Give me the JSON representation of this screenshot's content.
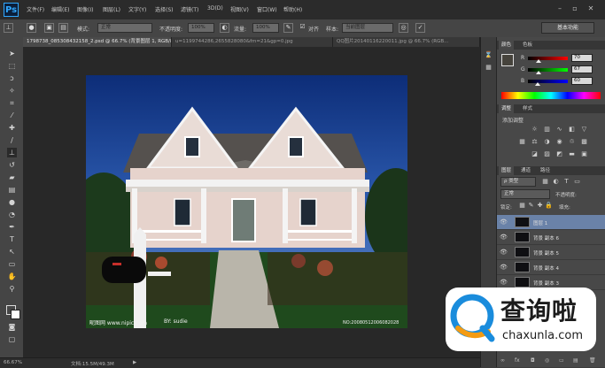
{
  "app": {
    "logo": "Ps",
    "menu": [
      "文件(F)",
      "编辑(E)",
      "图像(I)",
      "图层(L)",
      "文字(Y)",
      "选择(S)",
      "滤镜(T)",
      "3D(D)",
      "视图(V)",
      "窗口(W)",
      "帮助(H)"
    ],
    "window_controls": [
      "–",
      "▫",
      "✕"
    ]
  },
  "options": {
    "mode_label": "模式:",
    "mode_value": "正常",
    "opacity_label": "不透明度:",
    "opacity_value": "100%",
    "flow_label": "流量:",
    "flow_value": "100%",
    "align_label": "对齐",
    "sample_label": "样本:",
    "sample_value": "当前图层",
    "workspace": "基本功能"
  },
  "tabs": [
    {
      "label": "1798738_085308432158_2.psd @ 66.7% (背景图层 1, RGB/8#) *",
      "active": true
    },
    {
      "label": "u=1199744286,2655828080&fm=21&gp=0.jpg",
      "active": false
    },
    {
      "label": "QQ图片20140116220011.jpg @ 66.7% (RGB...",
      "active": false
    }
  ],
  "canvas": {
    "watermark_left": "昵图网 www.nipic.com",
    "watermark_mid": "BY: sudie",
    "watermark_right": "NO:20080512006082028"
  },
  "status": {
    "zoom": "66.67%",
    "doc": "文档:15.5M/49.3M"
  },
  "panels": {
    "color_tabs": [
      "颜色",
      "色板"
    ],
    "color": {
      "r_label": "R",
      "r_value": "70",
      "g_label": "G",
      "g_value": "67",
      "b_label": "B",
      "b_value": "60",
      "r_level": 0.27,
      "g_level": 0.26,
      "b_level": 0.24
    },
    "adjust_tabs": [
      "调整",
      "样式"
    ],
    "adjust_title": "添加调整",
    "layers_tabs": [
      "图层",
      "通道",
      "路径"
    ],
    "layers": {
      "filter_label": "ρ 类型",
      "blend": "正常",
      "opacity_label": "不透明度:",
      "lock_label": "锁定:",
      "fill_label": "填充:",
      "items": [
        {
          "name": "图层 1",
          "selected": true
        },
        {
          "name": "背景 副本 6",
          "selected": false
        },
        {
          "name": "背景 副本 5",
          "selected": false
        },
        {
          "name": "背景 副本 4",
          "selected": false
        },
        {
          "name": "背景 副本 3",
          "selected": false
        }
      ]
    },
    "bottom_icons": [
      "∞",
      "fx",
      "◘",
      "◎",
      "▭",
      "▤",
      "🗑"
    ]
  },
  "badge": {
    "cn": "查询啦",
    "en": "chaxunla.com",
    "accent": "#1a8cdc",
    "accent_orange": "#f39b13"
  }
}
